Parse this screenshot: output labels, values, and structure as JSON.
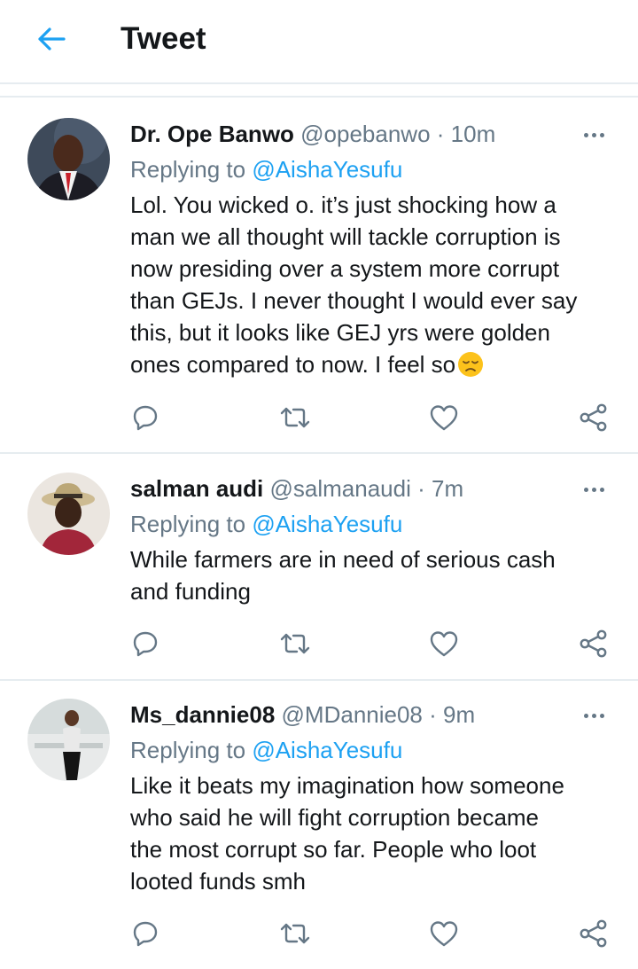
{
  "header": {
    "title": "Tweet",
    "back_icon": "arrow-left-icon"
  },
  "colors": {
    "accent": "#1da1f2",
    "text": "#14171a",
    "muted": "#657786",
    "divider": "#e6ecf0"
  },
  "tweets": [
    {
      "name": "Dr. Ope Banwo",
      "handle": "@opebanwo",
      "time": "· 10m",
      "replying_prefix": "Replying to",
      "replying_to": "@AishaYesufu",
      "lines": [
        "Lol. You wicked o. it’s just shocking how a",
        "man we all thought will tackle corruption is",
        "now presiding over a system more corrupt",
        "than GEJs. I never thought I would ever say",
        "this, but it looks like GEJ yrs were golden",
        "ones compared to now. I feel so"
      ],
      "emoji": "disappointed-face-icon"
    },
    {
      "name": "salman audi",
      "handle": "@salmanaudi",
      "time": "· 7m",
      "replying_prefix": "Replying to",
      "replying_to": "@AishaYesufu",
      "lines": [
        "While farmers are in need of serious cash",
        "and funding"
      ]
    },
    {
      "name": "Ms_dannie08",
      "handle": "@MDannie08",
      "time": "· 9m",
      "replying_prefix": "Replying to",
      "replying_to": "@AishaYesufu",
      "lines": [
        "Like it beats my imagination how someone",
        "who said he will fight corruption became",
        "the most corrupt so far. People who loot",
        "looted funds smh"
      ]
    }
  ],
  "action_icons": [
    "reply-icon",
    "retweet-icon",
    "like-icon",
    "share-icon"
  ]
}
